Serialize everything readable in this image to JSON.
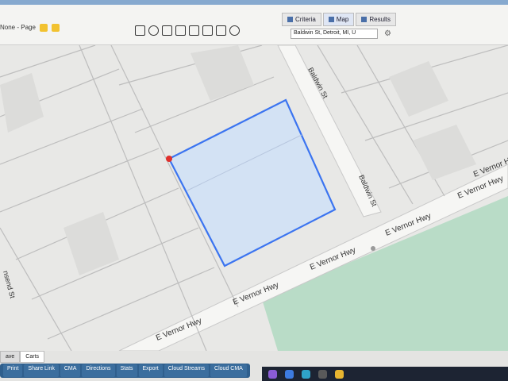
{
  "header": {
    "breadcrumb": "None - Page",
    "tabs": [
      {
        "label": "Criteria"
      },
      {
        "label": "Map"
      },
      {
        "label": "Results"
      }
    ],
    "address_value": "Baldwin St, Detroit, MI, U"
  },
  "map": {
    "streets": [
      {
        "label": "Baldwin St"
      },
      {
        "label": "Baldwin St"
      },
      {
        "label": "E Vernor Hwy"
      },
      {
        "label": "E Vernor Hwy"
      },
      {
        "label": "E Vernor Hwy"
      },
      {
        "label": "E Vernor Hwy"
      },
      {
        "label": "E Vernor Hwy"
      },
      {
        "label": "E Vernor Hwy"
      },
      {
        "label": "nsend St"
      }
    ],
    "selection_color": "#3b74f0",
    "park_color": "#b9dcc7"
  },
  "bottom": {
    "tabs": [
      {
        "label": "ave"
      },
      {
        "label": "Carts"
      }
    ],
    "actions": [
      {
        "label": "Print"
      },
      {
        "label": "Share Link"
      },
      {
        "label": "CMA"
      },
      {
        "label": "Directions"
      },
      {
        "label": "Stats"
      },
      {
        "label": "Export"
      },
      {
        "label": "Cloud Streams"
      },
      {
        "label": "Cloud CMA"
      }
    ]
  },
  "taskbar": {
    "icons": [
      "chat-icon",
      "browser-icon",
      "edge-icon",
      "store-icon",
      "chrome-icon"
    ]
  }
}
